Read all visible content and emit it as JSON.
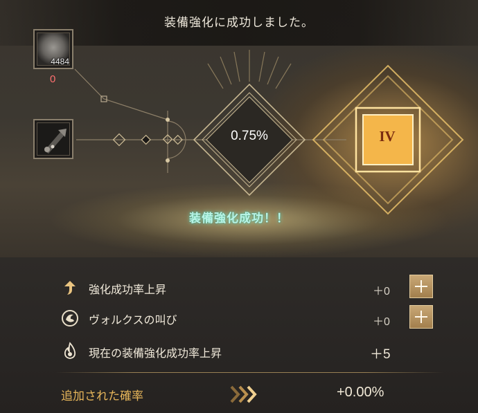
{
  "header": {
    "title": "装備強化に成功しました。"
  },
  "materials": {
    "stone": {
      "count": "4484",
      "owned": "0"
    }
  },
  "rate": {
    "value": "0.75%"
  },
  "result": {
    "rank": "IV",
    "banner": "装備強化成功！！"
  },
  "bonuses": [
    {
      "icon": "arrow-up-icon",
      "label": "強化成功率上昇",
      "value": "＋0"
    },
    {
      "icon": "volcus-emblem-icon",
      "label": "ヴォルクスの叫び",
      "value": "＋0"
    },
    {
      "icon": "flame-icon",
      "label": "現在の装備強化成功率上昇",
      "value": "＋5"
    }
  ],
  "extra": {
    "label": "追加された確率",
    "value": "+0.00%"
  },
  "colors": {
    "accent_gold": "#e7b65a",
    "banner_cyan": "#b9f4e6",
    "zero_red": "#ff7070"
  }
}
